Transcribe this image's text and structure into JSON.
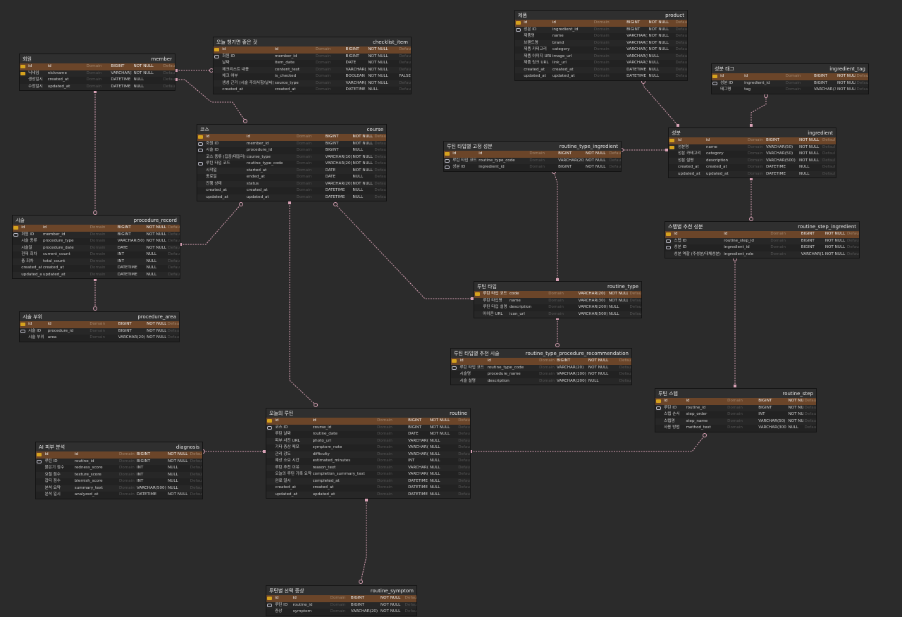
{
  "header_labels": {
    "id": "id",
    "domain": "Domain",
    "type": "BIGINT",
    "nn": "NOT NULL",
    "def": "Default value"
  },
  "colors": {
    "background": "#2b2b2b",
    "header_row": "#6b4529",
    "link": "#d9a2b6",
    "primary_key": "#d6a21e"
  },
  "tables": [
    {
      "key": "member",
      "title": "회원",
      "name": "member",
      "cols": [
        {
          "k": "pk",
          "label": "닉네임",
          "col": "nickname",
          "type": "VARCHAR(50)",
          "nn": "NOT NULL",
          "def": "Default value"
        },
        {
          "k": "",
          "label": "생성일시",
          "col": "created_at",
          "type": "DATETIME",
          "nn": "NULL",
          "def": "Default value"
        },
        {
          "k": "",
          "label": "수정일시",
          "col": "updated_at",
          "type": "DATETIME",
          "nn": "NULL",
          "def": "Default value"
        }
      ]
    },
    {
      "key": "checklist_item",
      "title": "오늘 챙기면 좋은 것",
      "name": "checklist_item",
      "cols": [
        {
          "k": "fk",
          "label": "회원 ID",
          "col": "member_id",
          "type": "BIGINT",
          "nn": "NOT NULL",
          "def": "Default value"
        },
        {
          "k": "",
          "label": "날짜",
          "col": "item_date",
          "type": "DATE",
          "nn": "NOT NULL",
          "def": "Default value"
        },
        {
          "k": "",
          "label": "체크리스트 내용",
          "col": "content_text",
          "type": "VARCHAR(200)",
          "nn": "NOT NULL",
          "def": "Default value"
        },
        {
          "k": "",
          "label": "체크 여부",
          "col": "is_checked",
          "type": "BOOLEAN",
          "nn": "NOT NULL",
          "def": "FALSE"
        },
        {
          "k": "",
          "label": "생성 근거 (시술 주의사항/날씨)",
          "col": "source_type",
          "type": "VARCHAR(30)",
          "nn": "NOT NULL",
          "def": "Default value"
        },
        {
          "k": "",
          "label": "created_at",
          "col": "created_at",
          "type": "DATETIME",
          "nn": "NULL",
          "def": "Default value"
        }
      ]
    },
    {
      "key": "product",
      "title": "제품",
      "name": "product",
      "cols": [
        {
          "k": "fk",
          "label": "성분 ID",
          "col": "ingredient_id",
          "type": "BIGINT",
          "nn": "NOT NULL",
          "def": "Default value"
        },
        {
          "k": "",
          "label": "제품명",
          "col": "name",
          "type": "VARCHAR(100)",
          "nn": "NOT NULL",
          "def": "Default value"
        },
        {
          "k": "",
          "label": "브랜드명",
          "col": "brand",
          "type": "VARCHAR(50)",
          "nn": "NOT NULL",
          "def": "Default value"
        },
        {
          "k": "",
          "label": "제품 카테고리",
          "col": "category",
          "type": "VARCHAR(30)",
          "nn": "NOT NULL",
          "def": "Default value"
        },
        {
          "k": "",
          "label": "제품 이미지 URL",
          "col": "image_url",
          "type": "VARCHAR(500)",
          "nn": "NULL",
          "def": "Default value"
        },
        {
          "k": "",
          "label": "제품 링크 URL",
          "col": "link_url",
          "type": "VARCHAR(500)",
          "nn": "NULL",
          "def": "Default value"
        },
        {
          "k": "",
          "label": "created_at",
          "col": "created_at",
          "type": "DATETIME",
          "nn": "NULL",
          "def": "Default value"
        },
        {
          "k": "",
          "label": "updated_at",
          "col": "updated_at",
          "type": "DATETIME",
          "nn": "NULL",
          "def": "Default value"
        }
      ]
    },
    {
      "key": "ingredient_tag",
      "title": "성분 태그",
      "name": "ingredient_tag",
      "cols": [
        {
          "k": "fk",
          "label": "성분 ID",
          "col": "ingredient_id",
          "type": "BIGINT",
          "nn": "NOT NULL",
          "def": "Default value"
        },
        {
          "k": "",
          "label": "태그명",
          "col": "tag",
          "type": "VARCHAR(30)",
          "nn": "NOT NULL",
          "def": "Default value"
        }
      ]
    },
    {
      "key": "course",
      "title": "코스",
      "name": "course",
      "cols": [
        {
          "k": "fk",
          "label": "회원 ID",
          "col": "member_id",
          "type": "BIGINT",
          "nn": "NOT NULL",
          "def": "Default value"
        },
        {
          "k": "fk",
          "label": "시술 ID",
          "col": "procedure_id",
          "type": "BIGINT",
          "nn": "NULL",
          "def": "Default value"
        },
        {
          "k": "",
          "label": "코스 종류 (집중/데일리)",
          "col": "course_type",
          "type": "VARCHAR(10)",
          "nn": "NOT NULL",
          "def": "Default value"
        },
        {
          "k": "fk",
          "label": "루틴 타입 코드",
          "col": "routine_type_code",
          "type": "VARCHAR(20)",
          "nn": "NOT NULL",
          "def": "Default value"
        },
        {
          "k": "",
          "label": "시작일",
          "col": "started_at",
          "type": "DATE",
          "nn": "NOT NULL",
          "def": "Default value"
        },
        {
          "k": "",
          "label": "종료일",
          "col": "ended_at",
          "type": "DATE",
          "nn": "NULL",
          "def": "Default value"
        },
        {
          "k": "",
          "label": "진행 상태",
          "col": "status",
          "type": "VARCHAR(20)",
          "nn": "NOT NULL",
          "def": "Default value"
        },
        {
          "k": "",
          "label": "created_at",
          "col": "created_at",
          "type": "DATETIME",
          "nn": "NULL",
          "def": "Default value"
        },
        {
          "k": "",
          "label": "updated_at",
          "col": "updated_at",
          "type": "DATETIME",
          "nn": "NULL",
          "def": "Default value"
        }
      ]
    },
    {
      "key": "routine_type_ingredient",
      "title": "루틴 타입별 고정 성분",
      "name": "routine_type_ingredient",
      "cols": [
        {
          "k": "fk",
          "label": "루틴 타입 코드",
          "col": "routine_type_code",
          "type": "VARCHAR(20)",
          "nn": "NOT NULL",
          "def": "Default value"
        },
        {
          "k": "fk",
          "label": "성분 ID",
          "col": "ingredient_id",
          "type": "BIGINT",
          "nn": "NOT NULL",
          "def": "Default value"
        }
      ]
    },
    {
      "key": "ingredient",
      "title": "성분",
      "name": "ingredient",
      "cols": [
        {
          "k": "pk",
          "label": "성분명",
          "col": "name",
          "type": "VARCHAR(50)",
          "nn": "NOT NULL",
          "def": "Default value"
        },
        {
          "k": "",
          "label": "성분 카테고리",
          "col": "category",
          "type": "VARCHAR(50)",
          "nn": "NOT NULL",
          "def": "Default value"
        },
        {
          "k": "",
          "label": "성분 설명",
          "col": "description",
          "type": "VARCHAR(500)",
          "nn": "NOT NULL",
          "def": "Default value"
        },
        {
          "k": "",
          "label": "created_at",
          "col": "created_at",
          "type": "DATETIME",
          "nn": "NULL",
          "def": "Default value"
        },
        {
          "k": "",
          "label": "updated_at",
          "col": "updated_at",
          "type": "DATETIME",
          "nn": "NULL",
          "def": "Default value"
        }
      ]
    },
    {
      "key": "procedure_record",
      "title": "시술",
      "name": "procedure_record",
      "cols": [
        {
          "k": "fk",
          "label": "회원 ID",
          "col": "member_id",
          "type": "BIGINT",
          "nn": "NOT NULL",
          "def": "Default value"
        },
        {
          "k": "",
          "label": "시술 종류",
          "col": "procedure_type",
          "type": "VARCHAR(50)",
          "nn": "NOT NULL",
          "def": "Default value"
        },
        {
          "k": "",
          "label": "시술일",
          "col": "procedure_date",
          "type": "DATE",
          "nn": "NOT NULL",
          "def": "Default value"
        },
        {
          "k": "",
          "label": "현재 회차",
          "col": "current_count",
          "type": "INT",
          "nn": "NULL",
          "def": "Default value"
        },
        {
          "k": "",
          "label": "총 회차",
          "col": "total_count",
          "type": "INT",
          "nn": "NULL",
          "def": "Default value"
        },
        {
          "k": "",
          "label": "created_at",
          "col": "created_at",
          "type": "DATETIME",
          "nn": "NULL",
          "def": "Default value"
        },
        {
          "k": "",
          "label": "updated_at",
          "col": "updated_at",
          "type": "DATETIME",
          "nn": "NULL",
          "def": "Default value"
        }
      ]
    },
    {
      "key": "routine_step_ingredient",
      "title": "스텝별 추천 성분",
      "name": "routine_step_ingredient",
      "cols": [
        {
          "k": "fk",
          "label": "스텝 ID",
          "col": "routine_step_id",
          "type": "BIGINT",
          "nn": "NOT NULL",
          "def": "Default value"
        },
        {
          "k": "fk",
          "label": "성분 ID",
          "col": "ingredient_id",
          "type": "BIGINT",
          "nn": "NOT NULL",
          "def": "Default value"
        },
        {
          "k": "",
          "label": "성분 역할 (주성분/대체성분)",
          "col": "ingredient_role",
          "type": "VARCHAR(10)",
          "nn": "NOT NULL",
          "def": "Default value"
        }
      ]
    },
    {
      "key": "routine_type",
      "title": "루틴 타입",
      "name": "routine_type",
      "hdr": {
        "c0": "루틴 타입 코드",
        "c1": "code",
        "type": "VARCHAR(20)"
      },
      "cols": [
        {
          "k": "",
          "label": "루틴 타입명",
          "col": "name",
          "type": "VARCHAR(30)",
          "nn": "NOT NULL",
          "def": "Default value"
        },
        {
          "k": "",
          "label": "루틴 타입 설명",
          "col": "description",
          "type": "VARCHAR(200)",
          "nn": "NULL",
          "def": "Default value"
        },
        {
          "k": "",
          "label": "아이콘 URL",
          "col": "icon_url",
          "type": "VARCHAR(500)",
          "nn": "NULL",
          "def": "Default value"
        }
      ]
    },
    {
      "key": "procedure_area",
      "title": "시술 부위",
      "name": "procedure_area",
      "cols": [
        {
          "k": "fk",
          "label": "시술 ID",
          "col": "procedure_id",
          "type": "BIGINT",
          "nn": "NOT NULL",
          "def": "Default value"
        },
        {
          "k": "",
          "label": "시술 부위",
          "col": "area",
          "type": "VARCHAR(20)",
          "nn": "NOT NULL",
          "def": "Default value"
        }
      ]
    },
    {
      "key": "routine_type_procedure_recommendation",
      "title": "루틴 타입별 추천 시술",
      "name": "routine_type_procedure_recommendation",
      "cols": [
        {
          "k": "fk",
          "label": "루틴 타입 코드",
          "col": "routine_type_code",
          "type": "VARCHAR(20)",
          "nn": "NOT NULL",
          "def": "Default value"
        },
        {
          "k": "",
          "label": "시술명",
          "col": "procedure_name",
          "type": "VARCHAR(100)",
          "nn": "NOT NULL",
          "def": "Default value"
        },
        {
          "k": "",
          "label": "시술 설명",
          "col": "description",
          "type": "VARCHAR(200)",
          "nn": "NULL",
          "def": "Default value"
        }
      ]
    },
    {
      "key": "routine_step",
      "title": "루틴 스텝",
      "name": "routine_step",
      "cols": [
        {
          "k": "fk",
          "label": "루틴 ID",
          "col": "routine_id",
          "type": "BIGINT",
          "nn": "NOT NULL",
          "def": "Default value"
        },
        {
          "k": "",
          "label": "스텝 순서",
          "col": "step_order",
          "type": "INT",
          "nn": "NOT NULL",
          "def": "Default value"
        },
        {
          "k": "",
          "label": "스텝명",
          "col": "step_name",
          "type": "VARCHAR(50)",
          "nn": "NOT NULL",
          "def": "Default value"
        },
        {
          "k": "",
          "label": "사용 방법",
          "col": "method_text",
          "type": "VARCHAR(300)",
          "nn": "NULL",
          "def": "Default value"
        }
      ]
    },
    {
      "key": "routine",
      "title": "오늘의 루틴",
      "name": "routine",
      "cols": [
        {
          "k": "fk",
          "label": "코스 ID",
          "col": "course_id",
          "type": "BIGINT",
          "nn": "NOT NULL",
          "def": "Default value"
        },
        {
          "k": "",
          "label": "루틴 날짜",
          "col": "routine_date",
          "type": "DATE",
          "nn": "NOT NULL",
          "def": "Default value"
        },
        {
          "k": "",
          "label": "피부 사진 URL",
          "col": "photo_url",
          "type": "VARCHAR(500)",
          "nn": "NULL",
          "def": "Default value"
        },
        {
          "k": "",
          "label": "기타 증상 메모",
          "col": "symptom_note",
          "type": "VARCHAR(500)",
          "nn": "NULL",
          "def": "Default value"
        },
        {
          "k": "",
          "label": "관리 강도",
          "col": "difficulty",
          "type": "VARCHAR(20)",
          "nn": "NULL",
          "def": "Default value"
        },
        {
          "k": "",
          "label": "예상 소요 시간",
          "col": "estimated_minutes",
          "type": "INT",
          "nn": "NULL",
          "def": "Default value"
        },
        {
          "k": "",
          "label": "루틴 추천 이유",
          "col": "reason_text",
          "type": "VARCHAR(500)",
          "nn": "NULL",
          "def": "Default value"
        },
        {
          "k": "",
          "label": "오늘의 루틴 기록 요약",
          "col": "completion_summary_text",
          "type": "VARCHAR(500)",
          "nn": "NULL",
          "def": "Default value"
        },
        {
          "k": "",
          "label": "완료 일시",
          "col": "completed_at",
          "type": "DATETIME",
          "nn": "NULL",
          "def": "Default value"
        },
        {
          "k": "",
          "label": "created_at",
          "col": "created_at",
          "type": "DATETIME",
          "nn": "NULL",
          "def": "Default value"
        },
        {
          "k": "",
          "label": "updated_at",
          "col": "updated_at",
          "type": "DATETIME",
          "nn": "NULL",
          "def": "Default value"
        }
      ]
    },
    {
      "key": "diagnosis",
      "title": "AI 피부 분석",
      "name": "diagnosis",
      "cols": [
        {
          "k": "fk",
          "label": "루틴 ID",
          "col": "routine_id",
          "type": "BIGINT",
          "nn": "NOT NULL",
          "def": "Default value"
        },
        {
          "k": "",
          "label": "붉은기 점수",
          "col": "redness_score",
          "type": "INT",
          "nn": "NULL",
          "def": "Default value"
        },
        {
          "k": "",
          "label": "요철 점수",
          "col": "texture_score",
          "type": "INT",
          "nn": "NULL",
          "def": "Default value"
        },
        {
          "k": "",
          "label": "잡티 점수",
          "col": "blemish_score",
          "type": "INT",
          "nn": "NULL",
          "def": "Default value"
        },
        {
          "k": "",
          "label": "분석 요약",
          "col": "summary_text",
          "type": "VARCHAR(500)",
          "nn": "NULL",
          "def": "Default value"
        },
        {
          "k": "",
          "label": "분석 일시",
          "col": "analyzed_at",
          "type": "DATETIME",
          "nn": "NOT NULL",
          "def": "Default value"
        }
      ]
    },
    {
      "key": "routine_symptom",
      "title": "루틴별 선택 증상",
      "name": "routine_symptom",
      "cols": [
        {
          "k": "fk",
          "label": "루틴 ID",
          "col": "routine_id",
          "type": "BIGINT",
          "nn": "NOT NULL",
          "def": "Default value"
        },
        {
          "k": "",
          "label": "증상",
          "col": "symptom",
          "type": "VARCHAR(20)",
          "nn": "NOT NULL",
          "def": "Default value"
        }
      ]
    }
  ]
}
